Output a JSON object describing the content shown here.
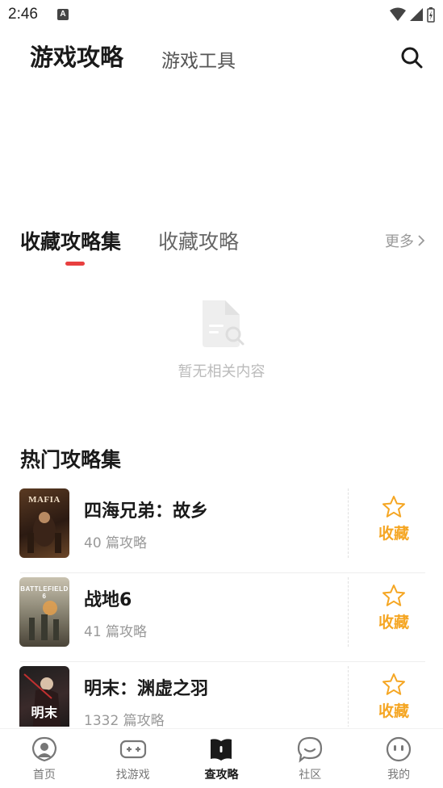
{
  "status_bar": {
    "time": "2:46",
    "notification_glyph": "A"
  },
  "header": {
    "main_tab": "游戏攻略",
    "tools_tab": "游戏工具",
    "search_icon": "search-icon"
  },
  "sub_tabs": {
    "active": "收藏攻略集",
    "inactive": "收藏攻略",
    "more": "更多",
    "accent_color": "#e83f3f"
  },
  "empty_state": {
    "text": "暂无相关内容",
    "icon": "document-search-icon"
  },
  "hot_section": {
    "title": "热门攻略集",
    "items": [
      {
        "title": "四海兄弟：故乡",
        "count": "40 篇攻略",
        "cover_text": "MAFIA",
        "fav_label": "收藏"
      },
      {
        "title": "战地6",
        "count": "41 篇攻略",
        "cover_text": "BATTLEFIELD 6",
        "fav_label": "收藏"
      },
      {
        "title": "明末：渊虚之羽",
        "count": "1332 篇攻略",
        "cover_text": "明末",
        "fav_label": "收藏"
      }
    ],
    "fav_color": "#f5a623"
  },
  "bottom_nav": {
    "items": [
      {
        "label": "首页",
        "icon": "home-icon"
      },
      {
        "label": "找游戏",
        "icon": "gamepad-icon"
      },
      {
        "label": "查攻略",
        "icon": "guide-book-icon",
        "active": true
      },
      {
        "label": "社区",
        "icon": "chat-bubble-icon"
      },
      {
        "label": "我的",
        "icon": "profile-face-icon"
      }
    ]
  }
}
